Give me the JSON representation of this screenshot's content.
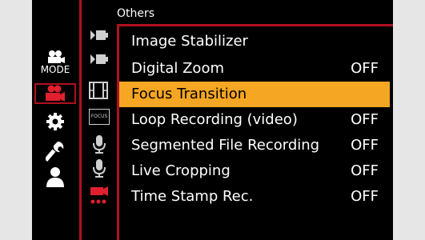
{
  "header": {
    "title": "Others"
  },
  "sidebar": {
    "mode_label": "MODE",
    "tabs": [
      {
        "name": "mode",
        "icon": "mode-camera-icon",
        "selected": false
      },
      {
        "name": "video",
        "icon": "video-camera-icon",
        "selected": true
      },
      {
        "name": "custom",
        "icon": "gear-icon",
        "selected": false
      },
      {
        "name": "setup",
        "icon": "wrench-icon",
        "selected": false
      },
      {
        "name": "my-menu",
        "icon": "person-icon",
        "selected": false
      }
    ],
    "subtabs": [
      {
        "icon": "stabilizer-icon"
      },
      {
        "icon": "stabilizer-icon"
      },
      {
        "icon": "film-icon"
      },
      {
        "icon": "focus-icon",
        "label": "FOCUS"
      },
      {
        "icon": "microphone-icon"
      },
      {
        "icon": "microphone-icon"
      },
      {
        "icon": "video-others-icon",
        "active": true
      }
    ]
  },
  "menu": {
    "items": [
      {
        "label": "Image Stabilizer",
        "value": ""
      },
      {
        "label": "Digital Zoom",
        "value": "OFF"
      },
      {
        "label": "Focus Transition",
        "value": "",
        "selected": true
      },
      {
        "label": "Loop Recording (video)",
        "value": "OFF"
      },
      {
        "label": "Segmented File Recording",
        "value": "OFF"
      },
      {
        "label": "Live Cropping",
        "value": "OFF"
      },
      {
        "label": "Time Stamp Rec.",
        "value": "OFF"
      }
    ]
  },
  "colors": {
    "accent": "#b0101f",
    "highlight": "#f5a623",
    "background": "#000000",
    "text": "#ffffff"
  }
}
